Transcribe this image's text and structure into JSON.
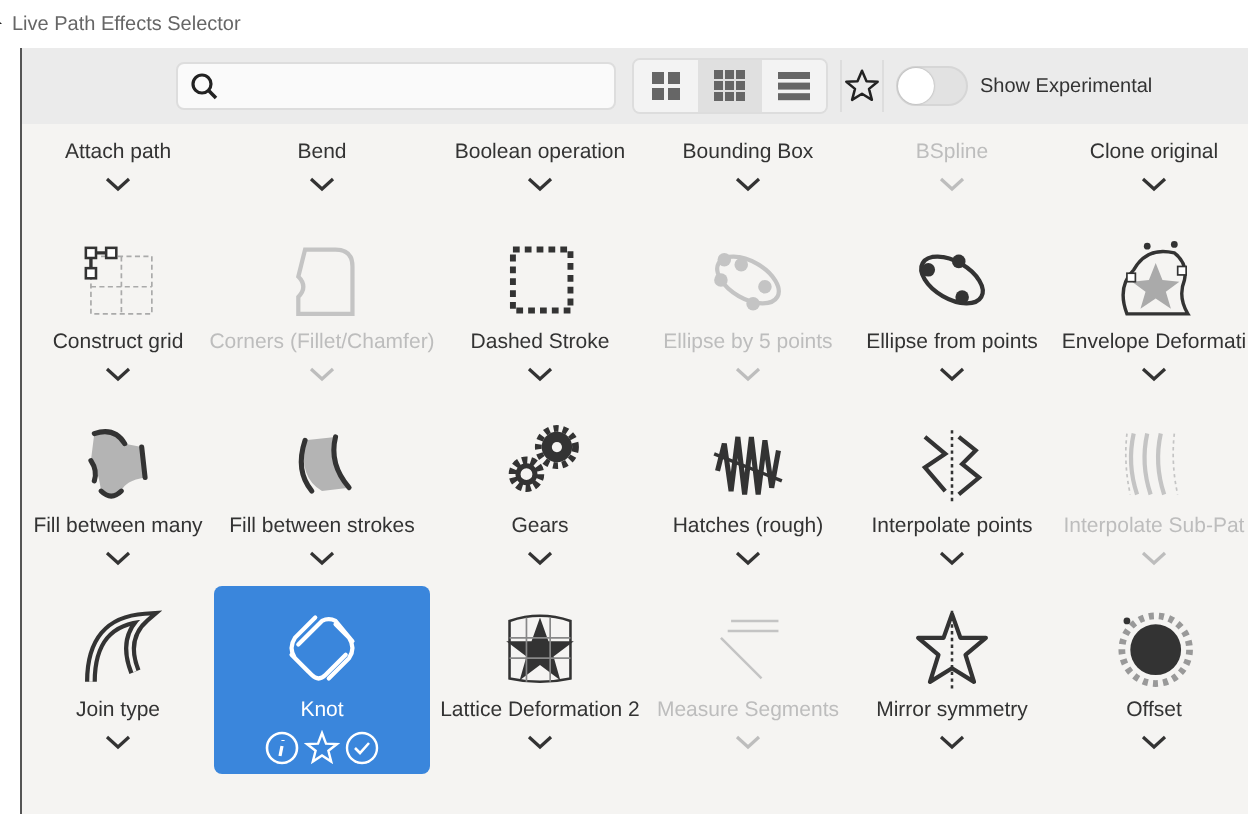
{
  "window": {
    "title": "Live Path Effects Selector"
  },
  "toolbar": {
    "view_modes": [
      {
        "selected": false
      },
      {
        "selected": true
      },
      {
        "selected": false
      }
    ],
    "show_experimental": {
      "label": "Show Experimental",
      "on": false
    }
  },
  "effects_partial": [
    {
      "name": "Attach path",
      "disabled": false
    },
    {
      "name": "Bend",
      "disabled": false
    },
    {
      "name": "Boolean operation",
      "disabled": false
    },
    {
      "name": "Bounding Box",
      "disabled": false
    },
    {
      "name": "BSpline",
      "disabled": true
    },
    {
      "name": "Clone original",
      "disabled": false
    }
  ],
  "effects": [
    {
      "name": "Construct grid",
      "disabled": false,
      "selected": false
    },
    {
      "name": "Corners (Fillet/Chamfer)",
      "disabled": true,
      "selected": false
    },
    {
      "name": "Dashed Stroke",
      "disabled": false,
      "selected": false
    },
    {
      "name": "Ellipse by 5 points",
      "disabled": true,
      "selected": false
    },
    {
      "name": "Ellipse from points",
      "disabled": false,
      "selected": false
    },
    {
      "name": "Envelope Deformati",
      "disabled": false,
      "selected": false
    },
    {
      "name": "Fill between many",
      "disabled": false,
      "selected": false
    },
    {
      "name": "Fill between strokes",
      "disabled": false,
      "selected": false
    },
    {
      "name": "Gears",
      "disabled": false,
      "selected": false
    },
    {
      "name": "Hatches (rough)",
      "disabled": false,
      "selected": false
    },
    {
      "name": "Interpolate points",
      "disabled": false,
      "selected": false
    },
    {
      "name": "Interpolate Sub-Pat",
      "disabled": true,
      "selected": false
    },
    {
      "name": "Join type",
      "disabled": false,
      "selected": false
    },
    {
      "name": "Knot",
      "disabled": false,
      "selected": true
    },
    {
      "name": "Lattice Deformation 2",
      "disabled": false,
      "selected": false
    },
    {
      "name": "Measure Segments",
      "disabled": true,
      "selected": false
    },
    {
      "name": "Mirror symmetry",
      "disabled": false,
      "selected": false
    },
    {
      "name": "Offset",
      "disabled": false,
      "selected": false
    }
  ]
}
